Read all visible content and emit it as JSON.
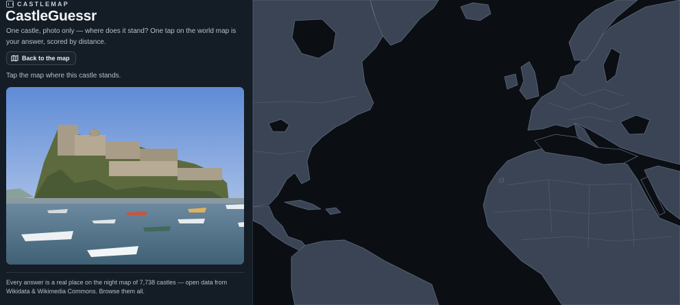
{
  "app": {
    "brand": "CASTLEMAP",
    "title": "CastleGuessr",
    "description": "One castle, photo only — where does it stand? One tap on the world map is your answer, scored by distance."
  },
  "actions": {
    "back_label": "Back to the map"
  },
  "prompt": "Tap the map where this castle stands.",
  "footer": "Every answer is a real place on the night map of 7,738 castles — open data from Wikidata & Wikimedia Commons. Browse them all.",
  "colors": {
    "panel_bg": "#141c25",
    "ocean": "#0b0f14",
    "land": "#3a4454",
    "land_border": "#5e6b7c"
  },
  "icons": {
    "brand": "castlemap-logo-icon",
    "back": "map-icon"
  }
}
